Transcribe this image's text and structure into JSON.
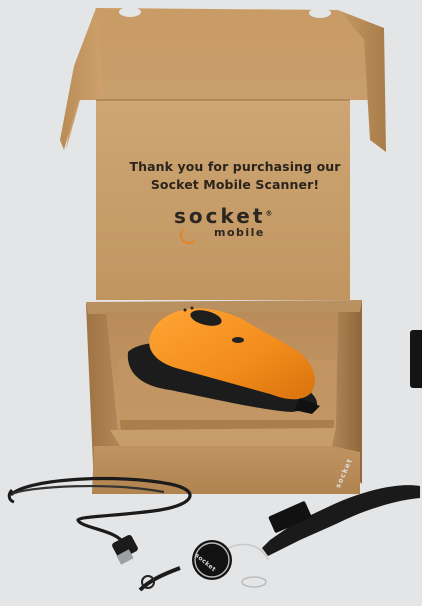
{
  "photo": {
    "box_message_line1": "Thank you for purchasing our",
    "box_message_line2": "Socket Mobile Scanner!",
    "brand_name": "socket",
    "brand_registered_mark": "®",
    "brand_sub": "mobile",
    "strap_print": "socket",
    "reel_print": "socket"
  },
  "colors": {
    "background": "#e4e5e7",
    "cardboard": "#c49a66",
    "scanner_body": "#f28b1a",
    "scanner_base": "#1c1c1c",
    "brand_accent": "#e4832a"
  },
  "icons": {
    "side_handle": "side-tab-icon"
  }
}
